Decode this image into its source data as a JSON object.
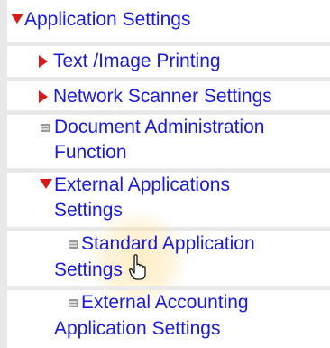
{
  "menu": {
    "root": {
      "label": "Application Settings",
      "icon": "triangle-down-icon"
    },
    "items": [
      {
        "label": "Text /Image Printing",
        "icon": "triangle-right-icon"
      },
      {
        "label": "Network Scanner Settings",
        "icon": "triangle-right-icon"
      },
      {
        "label_line1": "Document Administration",
        "label_line2": "Function",
        "icon": "document-icon"
      },
      {
        "label_line1": "External Applications",
        "label_line2": "Settings",
        "icon": "triangle-down-icon"
      },
      {
        "label_line1": "Standard Application",
        "label_line2": "Settings",
        "icon": "document-icon"
      },
      {
        "label_line1": "External Accounting",
        "label_line2": "Application Settings",
        "icon": "document-icon"
      }
    ]
  },
  "colors": {
    "link": "#1a1ad8",
    "arrow": "#d61a1a",
    "rail": "#e8e8e8"
  }
}
